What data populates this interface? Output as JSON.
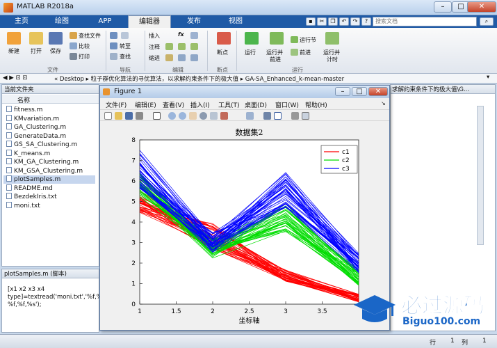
{
  "window": {
    "title": "MATLAB R2018a",
    "min": "–",
    "max": "□",
    "close": "✕"
  },
  "tabs": [
    "主页",
    "绘图",
    "APP",
    "编辑器",
    "发布",
    "视图"
  ],
  "active_tab": 3,
  "search_placeholder": "搜索文档",
  "ribbon": {
    "file": {
      "new": "新建",
      "open": "打开",
      "save": "保存",
      "find_files": "查找文件",
      "compare": "比较",
      "print": "打印",
      "group": "文件"
    },
    "nav": {
      "goto": "转至",
      "find": "查找",
      "group": "导航"
    },
    "edit": {
      "insert": "插入",
      "comment": "注释",
      "indent": "缩进",
      "fx": "fx",
      "group": "编辑"
    },
    "breakpoints": {
      "label": "断点",
      "group": "断点"
    },
    "run": {
      "run": "运行",
      "run_advance_1": "运行并",
      "run_advance_2": "前进",
      "run_section": "运行节",
      "advance": "前进",
      "run_time_1": "运行并",
      "run_time_2": "计时",
      "group": "运行"
    }
  },
  "address": {
    "arrows": "◀ ▶ ⊡ ⊡",
    "path": "« Desktop ▸ 粒子群优化算法的寻优算法，以求解约束条件下的极大值 ▸ GA-SA_Enhanced_k-mean-master"
  },
  "file_browser": {
    "title": "当前文件夹",
    "column": "名称",
    "files": [
      "fitness.m",
      "KMvariation.m",
      "GA_Clustering.m",
      "GenerateData.m",
      "GS_SA_Clustering.m",
      "K_means.m",
      "KM_GA_Clustering.m",
      "KM_GSA_Clustering.m",
      "plotSamples.m",
      "README.md",
      "BezdekIris.txt",
      "moni.txt"
    ],
    "selected": 8
  },
  "details": {
    "title": "plotSamples.m  (脚本)",
    "lines": [
      "[x1 x2 x3 x4",
      "type]=textread('moni.txt','%f,%f,",
      "%f,%f,%s');"
    ]
  },
  "editor_tab": "求解约束条件下的极大值\\G...",
  "figure": {
    "title": "Figure 1",
    "menu": [
      "文件(F)",
      "编辑(E)",
      "查看(V)",
      "插入(I)",
      "工具(T)",
      "桌面(D)",
      "窗口(W)",
      "帮助(H)"
    ]
  },
  "status": {
    "row_label": "行",
    "row": "1",
    "col_label": "列",
    "col": "1"
  },
  "watermark": {
    "main": "必过源码",
    "sub": "Biguo100.com"
  },
  "chart_data": {
    "type": "line",
    "title": "数据集2",
    "xlabel": "坐标轴",
    "ylabel": "",
    "xlim": [
      1,
      4
    ],
    "ylim": [
      0,
      8
    ],
    "x": [
      1,
      2,
      3,
      4
    ],
    "xticks": [
      "1",
      "1.5",
      "2",
      "2.5",
      "3",
      "3.5"
    ],
    "yticks": [
      "0",
      "1",
      "2",
      "3",
      "4",
      "5",
      "6",
      "7",
      "8"
    ],
    "legend": {
      "position": "top-right",
      "entries": [
        "c1",
        "c2",
        "c3"
      ]
    },
    "series": [
      {
        "name": "c1",
        "color": "#ff0000",
        "lines": 40,
        "mean": [
          5.0,
          3.3,
          1.4,
          0.3
        ],
        "spread": [
          0.35,
          0.4,
          0.18,
          0.12
        ]
      },
      {
        "name": "c2",
        "color": "#00dd00",
        "lines": 40,
        "mean": [
          5.8,
          2.7,
          4.2,
          1.3
        ],
        "spread": [
          0.4,
          0.3,
          0.45,
          0.25
        ]
      },
      {
        "name": "c3",
        "color": "#0000ff",
        "lines": 40,
        "mean": [
          6.6,
          3.0,
          5.6,
          2.0
        ],
        "spread": [
          0.6,
          0.3,
          0.55,
          0.3
        ]
      }
    ]
  },
  "colors": {
    "accent": "#1f5aa6",
    "figure_bg": "#f0f0f0"
  }
}
